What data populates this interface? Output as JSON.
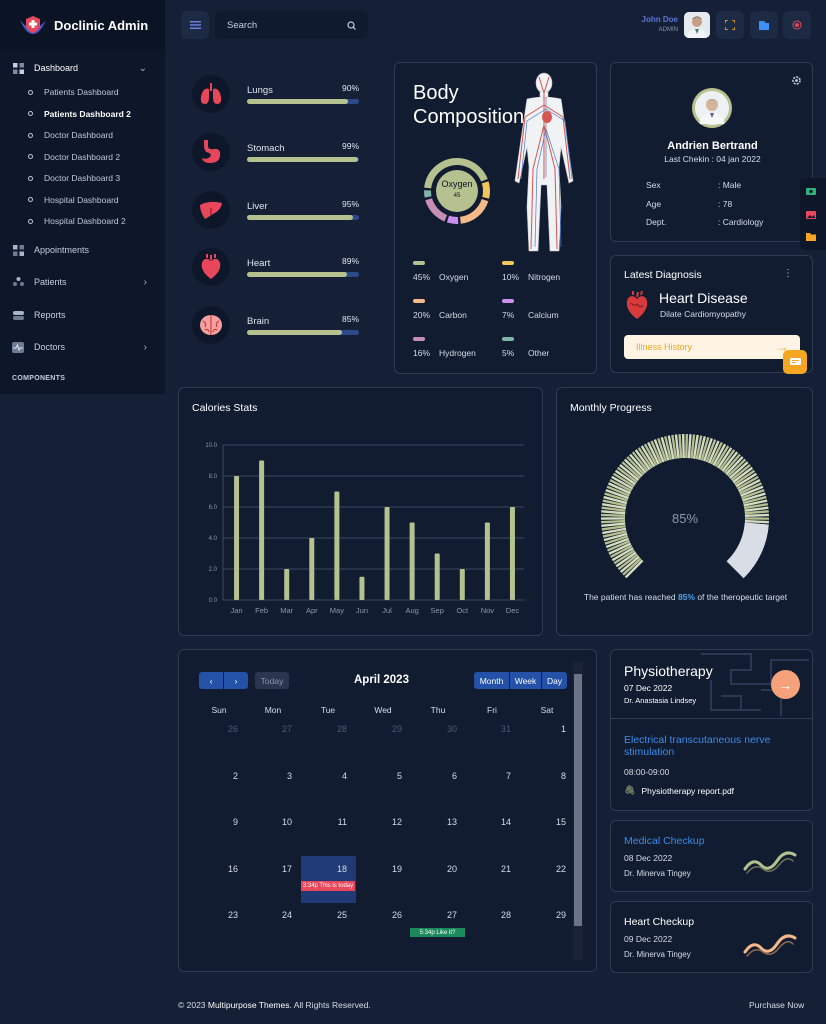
{
  "brand": {
    "name": "Doclinic Admin"
  },
  "sidebar": {
    "dashboard": "Dashboard",
    "submenu": [
      "Patients Dashboard",
      "Patients Dashboard 2",
      "Doctor Dashboard",
      "Doctor Dashboard 2",
      "Doctor Dashboard 3",
      "Hospital Dashboard",
      "Hospital Dashboard 2"
    ],
    "active_index": 1,
    "items": [
      "Appointments",
      "Patients",
      "Reports",
      "Doctors"
    ],
    "section": "COMPONENTS"
  },
  "topbar": {
    "search_placeholder": "Search",
    "user_name": "John Doe",
    "user_role": "ADMIN"
  },
  "organs": [
    {
      "name": "Lungs",
      "percent": "90%",
      "value": 90
    },
    {
      "name": "Stomach",
      "percent": "99%",
      "value": 99
    },
    {
      "name": "Liver",
      "percent": "95%",
      "value": 95
    },
    {
      "name": "Heart",
      "percent": "89%",
      "value": 89
    },
    {
      "name": "Brain",
      "percent": "85%",
      "value": 85
    }
  ],
  "body": {
    "title_line1": "Body",
    "title_line2": "Composition",
    "donut_label": "Oxygen",
    "donut_value": "45",
    "legend": [
      {
        "percent": "45%",
        "name": "Oxygen",
        "color": "#b5c18f"
      },
      {
        "percent": "10%",
        "name": "Nitrogen",
        "color": "#f0c75a"
      },
      {
        "percent": "20%",
        "name": "Carbon",
        "color": "#f5b98a"
      },
      {
        "percent": "7%",
        "name": "Calcium",
        "color": "#c98ef0"
      },
      {
        "percent": "16%",
        "name": "Hydrogen",
        "color": "#c58fb5"
      },
      {
        "percent": "5%",
        "name": "Other",
        "color": "#7fb5a8"
      }
    ]
  },
  "patient": {
    "name": "Andrien Bertrand",
    "last_checkin": "Last Chekin : 04 jan 2022",
    "fields": [
      {
        "label": "Sex",
        "value": ": Male"
      },
      {
        "label": "Age",
        "value": ": 78"
      },
      {
        "label": "Dept.",
        "value": ": Cardiology"
      }
    ]
  },
  "diagnosis": {
    "title": "Latest Diagnosis",
    "disease": "Heart Disease",
    "detail": "Dilate Cardiomyopathy",
    "history_button": "Illness History"
  },
  "calories": {
    "title": "Calories Stats"
  },
  "chart_data": {
    "type": "bar",
    "title": "Calories Stats",
    "categories": [
      "Jan",
      "Feb",
      "Mar",
      "Apr",
      "May",
      "Jun",
      "Jul",
      "Aug",
      "Sep",
      "Oct",
      "Nov",
      "Dec"
    ],
    "values": [
      8,
      9,
      2,
      4,
      7,
      1.5,
      6,
      5,
      3,
      2,
      5,
      6
    ],
    "yticks": [
      "0.0",
      "2.0",
      "4.0",
      "6.0",
      "8.0",
      "10.0"
    ],
    "ylim": [
      0,
      10
    ],
    "color": "#b5c18f",
    "grid": true
  },
  "progress": {
    "title": "Monthly Progress",
    "value": 85,
    "value_label": "85%",
    "text_before": "The patient has reached",
    "text_after": "of the theropeutic target"
  },
  "calendar": {
    "title": "April 2023",
    "today_button": "Today",
    "views": [
      "Month",
      "Week",
      "Day"
    ],
    "day_headers": [
      "Sun",
      "Mon",
      "Tue",
      "Wed",
      "Thu",
      "Fri",
      "Sat"
    ],
    "weeks": [
      [
        "26",
        "27",
        "28",
        "29",
        "30",
        "31",
        "1"
      ],
      [
        "2",
        "3",
        "4",
        "5",
        "6",
        "7",
        "8"
      ],
      [
        "9",
        "10",
        "11",
        "12",
        "13",
        "14",
        "15"
      ],
      [
        "16",
        "17",
        "18",
        "19",
        "20",
        "21",
        "22"
      ],
      [
        "23",
        "24",
        "25",
        "26",
        "27",
        "28",
        "29"
      ]
    ],
    "event_today": "3:34p This is today",
    "event_like": "5:34p Like it?"
  },
  "physio": {
    "title": "Physiotherapy",
    "date": "07 Dec 2022",
    "doctor": "Dr. Anastasia Lindsey",
    "treatment": "Electrical transcutaneous nerve stimulation",
    "time": "08:00-09:00",
    "file": "Physiotherapy report.pdf"
  },
  "medical": {
    "title": "Medical Checkup",
    "date": "08 Dec 2022",
    "doctor": "Dr. Minerva Tingey"
  },
  "heart_check": {
    "title": "Heart Checkup",
    "date": "09 Dec 2022",
    "doctor": "Dr. Minerva Tingey"
  },
  "footer": {
    "copyright_prefix": "© 2023 ",
    "company": "Multipurpose Themes",
    "copyright_suffix": ". All Rights Reserved.",
    "purchase": "Purchase Now"
  }
}
